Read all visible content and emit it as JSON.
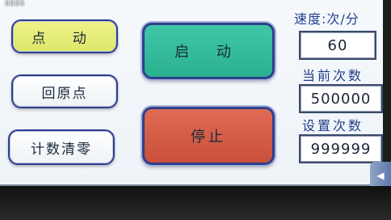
{
  "status": {
    "top_number": "8886"
  },
  "buttons": {
    "jog": "点 动",
    "home": "回原点",
    "clear": "计数清零",
    "start": "启 动",
    "stop": "停止"
  },
  "speed": {
    "label": "速度:次/分",
    "value": "60"
  },
  "count": {
    "label": "当前次数",
    "value": "500000"
  },
  "set": {
    "label": "设置次数",
    "value": "999999"
  },
  "icons": {
    "side_tab": "arrow-left-icon"
  },
  "colors": {
    "jog": "#dde86a",
    "start": "#2bb08f",
    "stop": "#c9503a",
    "label_blue": "#233d8c",
    "border_navy": "#2e3f8f"
  }
}
